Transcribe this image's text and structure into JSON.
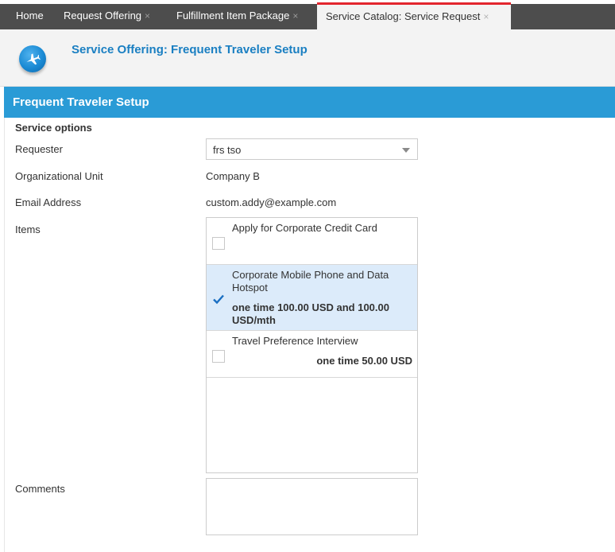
{
  "tabs": [
    {
      "label": "Home",
      "closable": false
    },
    {
      "label": "Request Offering",
      "closable": true
    },
    {
      "label": "Fulfillment Item Package",
      "closable": true
    },
    {
      "label": "Service Catalog: Service Request",
      "closable": true,
      "active": true
    }
  ],
  "close_glyph": "×",
  "header": {
    "title": "Service Offering: Frequent Traveler Setup",
    "icon": "airplane-icon"
  },
  "section": {
    "title": "Frequent Traveler Setup"
  },
  "form": {
    "subheading": "Service options",
    "requester": {
      "label": "Requester",
      "value": "frs tso"
    },
    "org_unit": {
      "label": "Organizational Unit",
      "value": "Company B"
    },
    "email": {
      "label": "Email Address",
      "value": "custom.addy@example.com"
    },
    "items": {
      "label": "Items",
      "list": [
        {
          "name": "Apply for Corporate Credit Card",
          "price": "",
          "checked": false
        },
        {
          "name": "Corporate Mobile Phone and Data Hotspot",
          "price": "one time 100.00 USD and 100.00 USD/mth",
          "checked": true
        },
        {
          "name": "Travel Preference Interview",
          "price": "one time 50.00 USD",
          "checked": false
        }
      ]
    },
    "comments": {
      "label": "Comments",
      "value": ""
    }
  },
  "colors": {
    "accent": "#2a9bd6",
    "active_tab_marker": "#e3262e",
    "title_blue": "#1a7fc2",
    "selected_row": "#dcebfa"
  }
}
